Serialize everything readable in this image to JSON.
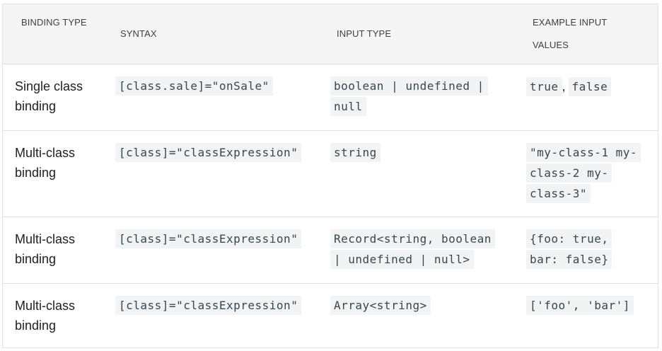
{
  "table": {
    "headers": {
      "binding_type": "BINDING TYPE",
      "syntax": "SYNTAX",
      "input_type": "INPUT TYPE",
      "example_values": "EXAMPLE INPUT VALUES"
    },
    "rows": [
      {
        "binding_type": "Single class binding",
        "syntax": "[class.sale]=\"onSale\"",
        "input_type": "boolean | undefined | null",
        "example_values": [
          "true",
          "false"
        ],
        "example_separator": ","
      },
      {
        "binding_type": "Multi-class binding",
        "syntax": "[class]=\"classExpression\"",
        "input_type": "string",
        "example_values": [
          "\"my-class-1 my-class-2 my-class-3\""
        ]
      },
      {
        "binding_type": "Multi-class binding",
        "syntax": "[class]=\"classExpression\"",
        "input_type": "Record<string, boolean | undefined | null>",
        "example_values": [
          "{foo: true, bar: false}"
        ]
      },
      {
        "binding_type": "Multi-class binding",
        "syntax": "[class]=\"classExpression\"",
        "input_type": "Array<string>",
        "example_values": [
          "['foo', 'bar']"
        ]
      }
    ]
  }
}
